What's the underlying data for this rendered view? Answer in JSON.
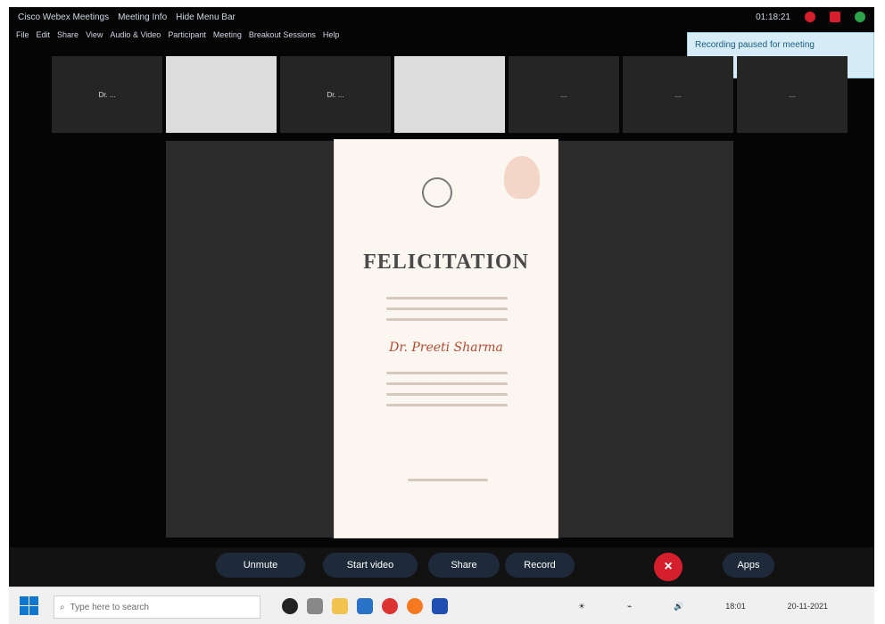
{
  "app": {
    "title": "Cisco Webex Meetings",
    "meeting_info": "Meeting Info",
    "host_label": "Hide Menu Bar"
  },
  "menu": [
    "File",
    "Edit",
    "Share",
    "View",
    "Audio & Video",
    "Participant",
    "Meeting",
    "Breakout Sessions",
    "Help"
  ],
  "recording": {
    "time": "01:18:21"
  },
  "toast": {
    "text": "Recording paused for meeting"
  },
  "tiles": [
    {
      "name": "Dr. ..."
    },
    {
      "name": ""
    },
    {
      "name": "Dr. ..."
    },
    {
      "name": ""
    },
    {
      "name": "..."
    },
    {
      "name": "..."
    },
    {
      "name": "..."
    }
  ],
  "document": {
    "title": "FELICITATION",
    "recipient": "Dr. Preeti Sharma"
  },
  "toolbar": {
    "mute": "Unmute",
    "start_video": "Start video",
    "share": "Share",
    "record": "Record",
    "apps": "Apps"
  },
  "taskbar": {
    "search_placeholder": "Type here to search",
    "time": "18:01",
    "date": "20-11-2021"
  },
  "colors": {
    "accent": "#1177cc",
    "end_call": "#d61f2d"
  }
}
